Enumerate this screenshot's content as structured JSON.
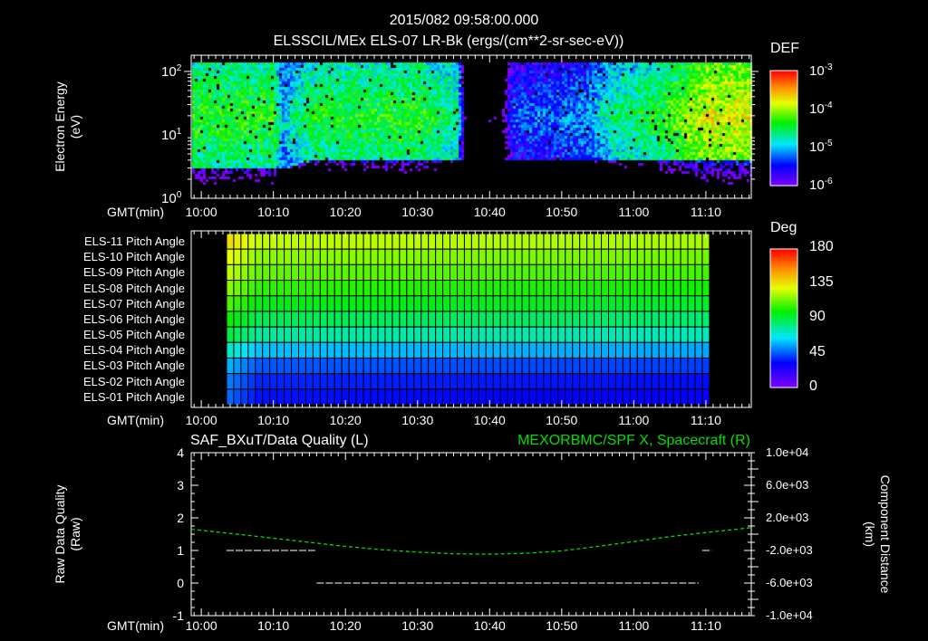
{
  "header": {
    "timestamp": "2015/082 09:58:00.000",
    "title": "ELSSCIL/MEx ELS-07 LR-Bk  (ergs/(cm**2-sr-sec-eV))"
  },
  "time_axis": {
    "label": "GMT(min)",
    "ticks": [
      "10:00",
      "10:10",
      "10:20",
      "10:30",
      "10:40",
      "10:50",
      "11:00",
      "11:10"
    ],
    "tick_minutes_after_1000": [
      0,
      10,
      20,
      30,
      40,
      50,
      60,
      70
    ],
    "range_minutes_after_1000": [
      -1.4,
      76.3
    ]
  },
  "chart_data": [
    {
      "type": "heatmap",
      "name": "electron-energy-spectrogram",
      "ylabel_line1": "Electron Energy",
      "ylabel_line2": "(eV)",
      "yscale": "log",
      "ylim": [
        1,
        180
      ],
      "yticks": [
        {
          "base": "10",
          "exp": "0",
          "value": 1
        },
        {
          "base": "10",
          "exp": "1",
          "value": 10
        },
        {
          "base": "10",
          "exp": "2",
          "value": 100
        }
      ],
      "colorbar": {
        "title": "DEF",
        "scale": "log",
        "range": [
          1e-06,
          0.001
        ],
        "ticks": [
          {
            "base": "10",
            "exp": "-3"
          },
          {
            "base": "10",
            "exp": "-4"
          },
          {
            "base": "10",
            "exp": "-5"
          },
          {
            "base": "10",
            "exp": "-6"
          }
        ]
      },
      "profile": {
        "note_minutes": [
          -1.4,
          10,
          11,
          15,
          30,
          35.5,
          36.5,
          41.5,
          43,
          48,
          53,
          57,
          63,
          70,
          76.3
        ],
        "peak_log_def": [
          -4.3,
          -4.3,
          -4.9,
          -4.4,
          -4.3,
          -4.6,
          -6.5,
          -6.5,
          -5.3,
          -5.2,
          -5.1,
          -4.6,
          -4.4,
          -3.8,
          -3.8
        ],
        "low_energy_cutoff_ev": [
          3,
          3,
          3,
          4,
          4,
          4,
          4,
          4,
          4,
          4,
          4,
          4,
          4,
          4,
          4
        ]
      }
    },
    {
      "type": "heatmap",
      "name": "pitch-angle-panel",
      "rows": [
        "ELS-11 Pitch Angle",
        "ELS-10 Pitch Angle",
        "ELS-09 Pitch Angle",
        "ELS-08 Pitch Angle",
        "ELS-07 Pitch Angle",
        "ELS-06 Pitch Angle",
        "ELS-05 Pitch Angle",
        "ELS-04 Pitch Angle",
        "ELS-03 Pitch Angle",
        "ELS-02 Pitch Angle",
        "ELS-01 Pitch Angle"
      ],
      "row_values_deg": [
        125,
        118,
        112,
        105,
        97,
        88,
        78,
        60,
        45,
        38,
        35
      ],
      "data_minutes": [
        3.5,
        70.5
      ],
      "colorbar": {
        "title": "Deg",
        "range": [
          0,
          180
        ],
        "ticks": [
          "180",
          "135",
          "90",
          "45",
          "0"
        ]
      }
    },
    {
      "type": "line",
      "name": "data-quality-and-position",
      "left_title": "SAF_BXuT/Data Quality (L)",
      "right_title": "MEXORBMC/SPF X, Spacecraft (R)",
      "ylabel_left_line1": "Raw Data Quality",
      "ylabel_left_line2": "(Raw)",
      "ylabel_right_line1": "Component Distance",
      "ylabel_right_line2": "(km)",
      "ylim_left": [
        -1,
        4
      ],
      "yticks_left": [
        "4",
        "3",
        "2",
        "1",
        "0",
        "-1"
      ],
      "ylim_right": [
        -10000,
        10000
      ],
      "yticks_right": [
        "1.0e+04",
        "6.0e+03",
        "2.0e+03",
        "-2.0e+03",
        "-6.0e+03",
        "-1.0e+04"
      ],
      "quality_segments": [
        {
          "start": 3.5,
          "end": 16,
          "value": 1
        },
        {
          "start": 16,
          "end": 69,
          "value": 0
        },
        {
          "start": 69.5,
          "end": 70.8,
          "value": 1
        }
      ],
      "position_series": {
        "color": "#00e000",
        "minutes": [
          -1.4,
          5,
          10,
          15,
          20,
          25,
          30,
          35,
          40,
          45,
          50,
          55,
          60,
          65,
          70,
          76.3
        ],
        "values_km": [
          600,
          0,
          -500,
          -1000,
          -1500,
          -1900,
          -2200,
          -2400,
          -2450,
          -2350,
          -2050,
          -1500,
          -900,
          -300,
          200,
          800
        ]
      }
    }
  ]
}
